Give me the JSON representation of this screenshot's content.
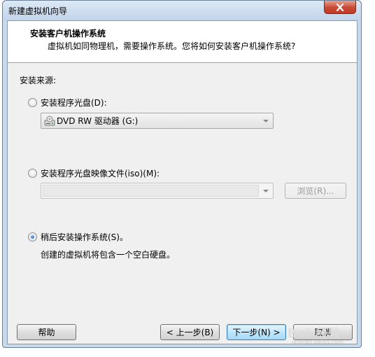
{
  "window": {
    "title": "新建虚拟机向导",
    "close_icon": "close-icon"
  },
  "header": {
    "title": "安装客户机操作系统",
    "subtitle": "虚拟机如同物理机，需要操作系统。您将如何安装客户机操作系统?"
  },
  "install_source": {
    "label": "安装来源:",
    "options": [
      {
        "label": "安装程序光盘(D):",
        "checked": false
      },
      {
        "label": "安装程序光盘映像文件(iso)(M):",
        "checked": false
      },
      {
        "label": "稍后安装操作系统(S)。",
        "checked": true
      }
    ],
    "disc_drive": {
      "value": "DVD RW 驱动器 (G:)",
      "icon": "dvd-drive-icon"
    },
    "iso_path": {
      "value": ""
    },
    "browse_label": "浏览(R)...",
    "later_description": "创建的虚拟机将包含一个空白硬盘。"
  },
  "footer": {
    "help_label": "帮助",
    "back_label": "< 上一步(B)",
    "next_label": "下一步(N) >",
    "cancel_label": "取消"
  },
  "watermark": {
    "text": "Bai 经验",
    "sub": "jingyan.baidu.com"
  },
  "colors": {
    "accent": "#3c7fb1",
    "close_red": "#c74a35",
    "frame": "#c9d9ec"
  }
}
